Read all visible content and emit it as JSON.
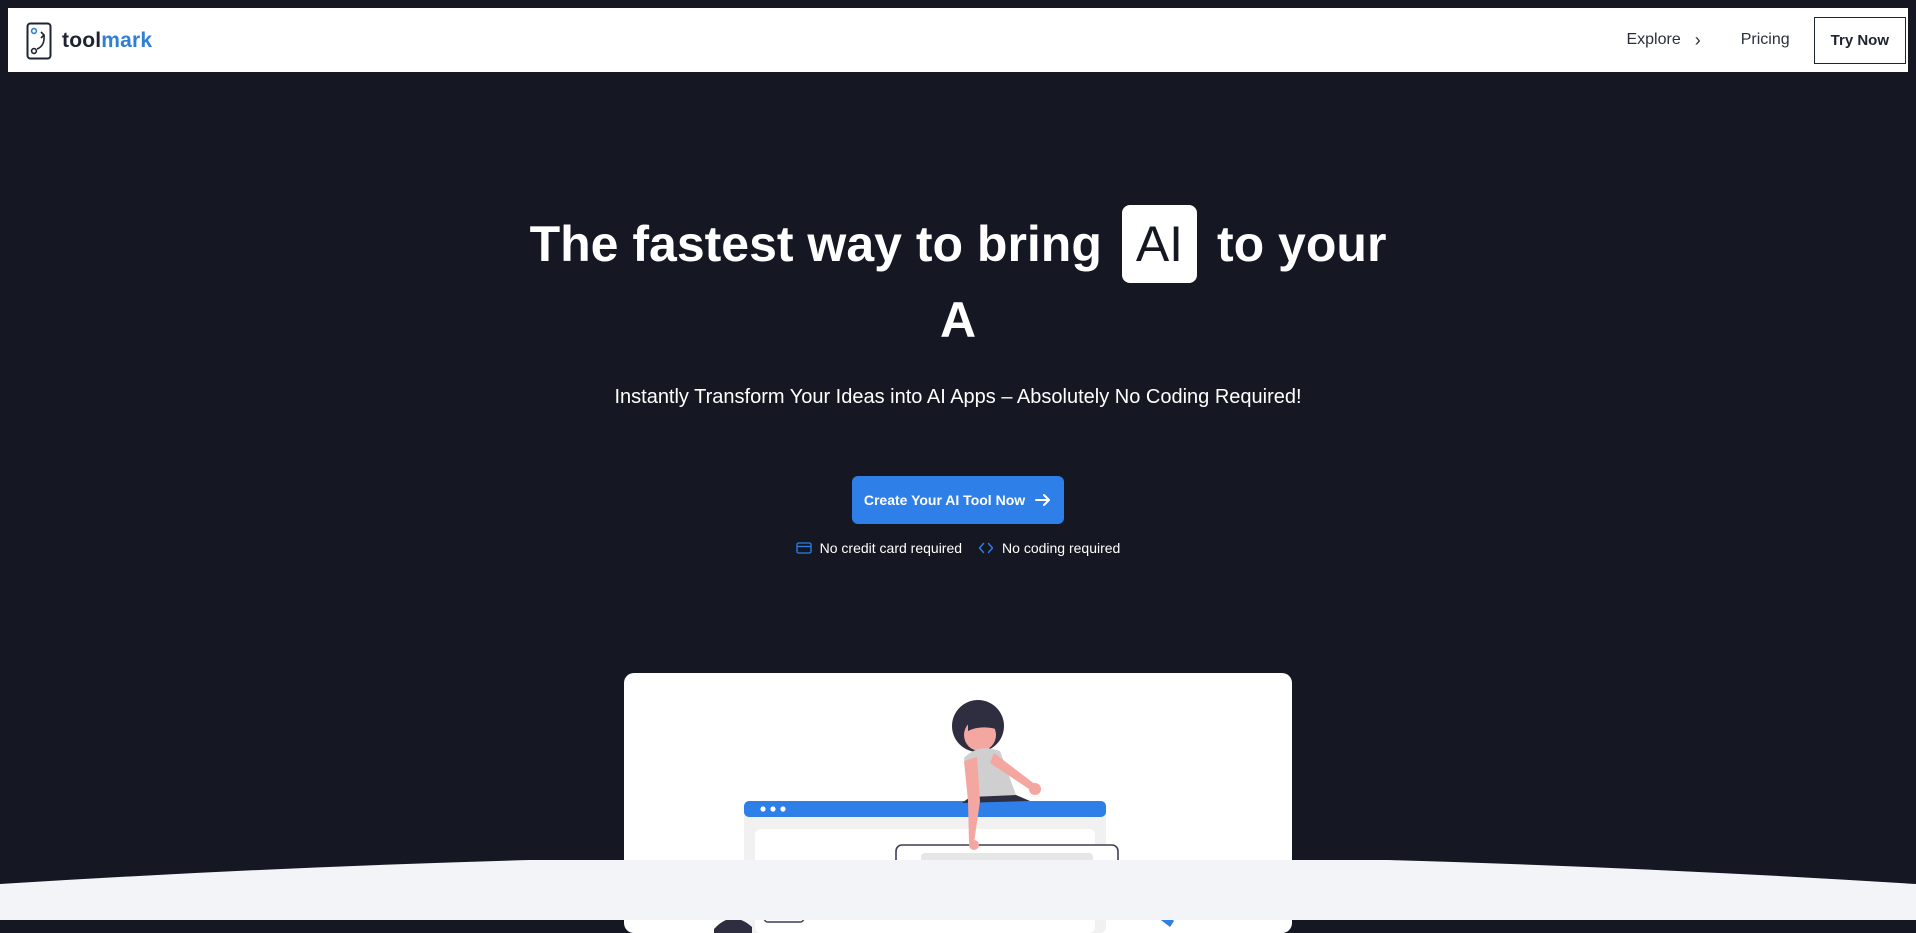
{
  "brand": {
    "name_part1": "tool",
    "name_part2": "mark"
  },
  "nav": {
    "explore": "Explore",
    "pricing": "Pricing",
    "try_now": "Try Now"
  },
  "hero": {
    "title_before": "The fastest way to bring",
    "title_badge": "AI",
    "title_after": "to your",
    "title_line2": "A",
    "subtitle": "Instantly Transform Your Ideas into AI Apps – Absolutely No Coding Required!",
    "cta": "Create Your AI Tool Now"
  },
  "features": [
    {
      "icon": "credit-card-icon",
      "label": "No credit card required"
    },
    {
      "icon": "code-icon",
      "label": "No coding required"
    }
  ],
  "colors": {
    "background": "#151822",
    "accent": "#2f7fe8",
    "navbar": "#ffffff"
  }
}
